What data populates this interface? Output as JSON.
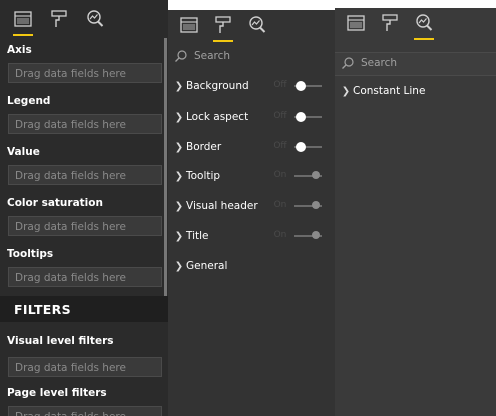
{
  "fields_pane": {
    "wells": [
      {
        "title": "Axis",
        "placeholder": "Drag data fields here"
      },
      {
        "title": "Legend",
        "placeholder": "Drag data fields here"
      },
      {
        "title": "Value",
        "placeholder": "Drag data fields here"
      },
      {
        "title": "Color saturation",
        "placeholder": "Drag data fields here"
      },
      {
        "title": "Tooltips",
        "placeholder": "Drag data fields here"
      }
    ],
    "filters_heading": "FILTERS",
    "filter_wells": [
      {
        "title": "Visual level filters",
        "placeholder": "Drag data fields here"
      },
      {
        "title": "Page level filters",
        "placeholder": "Drag data fields here"
      }
    ]
  },
  "format_pane": {
    "search_placeholder": "Search",
    "rows": [
      {
        "label": "Background",
        "state": "Off"
      },
      {
        "label": "Lock aspect",
        "state": "Off"
      },
      {
        "label": "Border",
        "state": "Off"
      },
      {
        "label": "Tooltip",
        "state": "On"
      },
      {
        "label": "Visual header",
        "state": "On"
      },
      {
        "label": "Title",
        "state": "On"
      },
      {
        "label": "General",
        "state": ""
      }
    ]
  },
  "analytics_pane": {
    "search_placeholder": "Search",
    "rows": [
      {
        "label": "Constant Line"
      }
    ]
  },
  "icons": {
    "fields": "fields-well-icon",
    "format": "paint-roller-icon",
    "analytics": "analytics-magnifier-icon"
  },
  "colors": {
    "accent": "#f2c811",
    "pane_dark": "#2b2b2b",
    "pane_mid": "#333333",
    "pane_light": "#3a3a3a"
  }
}
